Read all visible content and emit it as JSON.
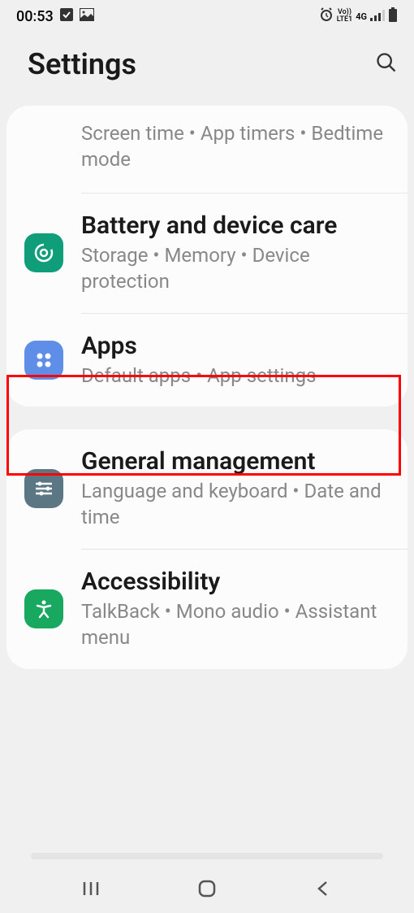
{
  "status": {
    "time": "00:53",
    "net_top": "Vo))",
    "net_bottom": "LTE1",
    "net_gen": "4G"
  },
  "header": {
    "title": "Settings"
  },
  "card1": {
    "screentime": {
      "sub": "Screen time  •  App timers  •  Bedtime mode"
    },
    "battery": {
      "title": "Battery and device care",
      "sub": "Storage  •  Memory  •  Device protection"
    },
    "apps": {
      "title": "Apps",
      "sub": "Default apps  •  App settings"
    }
  },
  "card2": {
    "general": {
      "title": "General management",
      "sub": "Language and keyboard  •  Date and time"
    },
    "accessibility": {
      "title": "Accessibility",
      "sub": "TalkBack  •  Mono audio  •  Assistant menu"
    }
  },
  "colors": {
    "battery_icon": "#0f9d7a",
    "apps_icon": "#5f8ee8",
    "general_icon": "#5c7784",
    "accessibility_icon": "#18a85f"
  }
}
